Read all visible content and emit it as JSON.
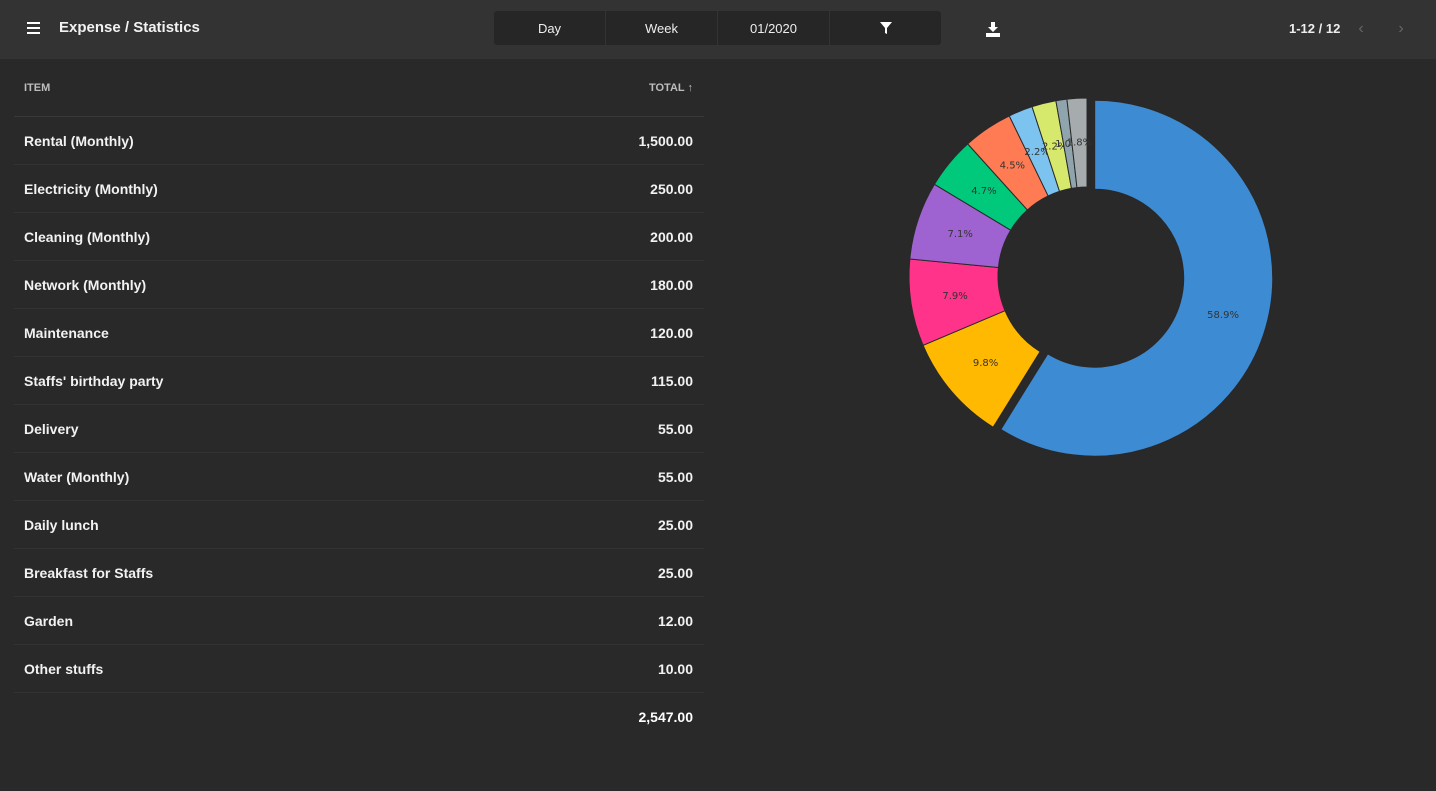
{
  "header": {
    "title": "Expense / Statistics",
    "segments": [
      "Day",
      "Week",
      "01/2020"
    ],
    "pager": "1-12 / 12"
  },
  "table": {
    "columns": {
      "item": "ITEM",
      "total": "TOTAL"
    },
    "rows": [
      {
        "item": "Rental (Monthly)",
        "total": "1,500.00"
      },
      {
        "item": "Electricity (Monthly)",
        "total": "250.00"
      },
      {
        "item": "Cleaning (Monthly)",
        "total": "200.00"
      },
      {
        "item": "Network (Monthly)",
        "total": "180.00"
      },
      {
        "item": "Maintenance",
        "total": "120.00"
      },
      {
        "item": "Staffs' birthday party",
        "total": "115.00"
      },
      {
        "item": "Delivery",
        "total": "55.00"
      },
      {
        "item": "Water (Monthly)",
        "total": "55.00"
      },
      {
        "item": "Daily lunch",
        "total": "25.00"
      },
      {
        "item": "Breakfast for Staffs",
        "total": "25.00"
      },
      {
        "item": "Garden",
        "total": "12.00"
      },
      {
        "item": "Other stuffs",
        "total": "10.00"
      }
    ],
    "grand_total": "2,547.00"
  },
  "chart_data": {
    "type": "pie",
    "donut": true,
    "labels": [
      "Rental (Monthly)",
      "Electricity (Monthly)",
      "Cleaning (Monthly)",
      "Network (Monthly)",
      "Maintenance",
      "Staffs' birthday party",
      "Delivery",
      "Water (Monthly)",
      "Daily lunch",
      "Other"
    ],
    "values": [
      58.9,
      9.8,
      7.9,
      7.1,
      4.7,
      4.5,
      2.2,
      2.2,
      1.0,
      1.8
    ],
    "value_labels": [
      "58.9%",
      "9.8%",
      "7.9%",
      "7.1%",
      "4.7%",
      "4.5%",
      "2.2%",
      "2.2%",
      "1.0%",
      "1.8%"
    ],
    "colors": [
      "#3d8bd3",
      "#ffb900",
      "#ff3389",
      "#9f63d1",
      "#00c97b",
      "#ff7b53",
      "#7cc3f0",
      "#d7e96d",
      "#90a4ae",
      "#a6abae"
    ]
  }
}
